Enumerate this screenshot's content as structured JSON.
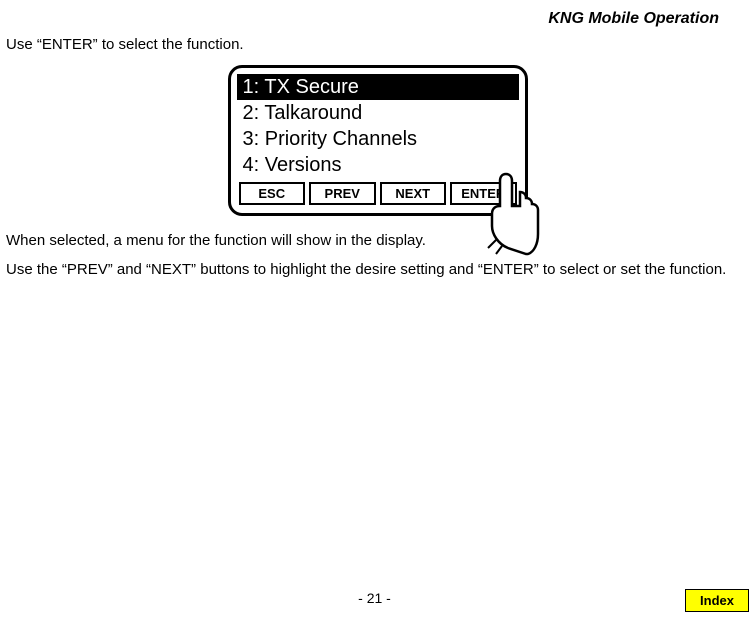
{
  "header": {
    "title": "KNG Mobile Operation"
  },
  "instructions": {
    "line1": "Use “ENTER” to select the function.",
    "line2": "When selected, a menu for the function will show in the display.",
    "line3": "Use the “PREV” and “NEXT” buttons to highlight the desire setting and “ENTER” to select or set the function."
  },
  "device": {
    "menu": [
      {
        "label": "1: TX Secure",
        "selected": true
      },
      {
        "label": "2: Talkaround",
        "selected": false
      },
      {
        "label": "3: Priority Channels",
        "selected": false
      },
      {
        "label": "4: Versions",
        "selected": false
      }
    ],
    "buttons": {
      "esc": "ESC",
      "prev": "PREV",
      "next": "NEXT",
      "enter": "ENTER"
    }
  },
  "footer": {
    "page": "- 21 -",
    "index": "Index"
  }
}
